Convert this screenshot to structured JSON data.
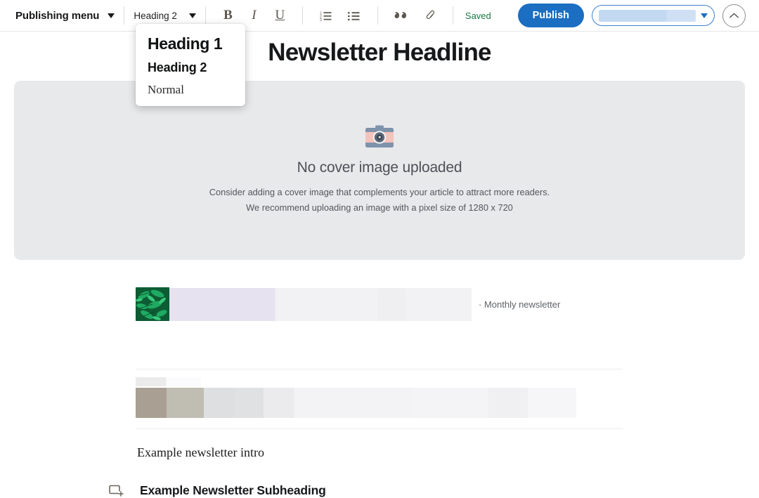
{
  "toolbar": {
    "publishing_menu_label": "Publishing menu",
    "style_selector_value": "Heading 2",
    "bold_label": "B",
    "italic_label": "I",
    "underline_label": "U",
    "numbered_list_icon": "numbered-list-icon",
    "bullet_list_icon": "bullet-list-icon",
    "quote_icon": "blockquote-icon",
    "link_icon": "link-icon",
    "save_status": "Saved",
    "save_status_color": "#1b7a45",
    "publish_label": "Publish",
    "publish_button_color": "#1b6ec2",
    "publish_select_value": "",
    "collapse_icon": "chevron-up-icon"
  },
  "style_dropdown": {
    "options": [
      {
        "label": "Heading 1",
        "style": "h1"
      },
      {
        "label": "Heading 2",
        "style": "h2"
      },
      {
        "label": "Normal",
        "style": "normal"
      }
    ]
  },
  "editor": {
    "headline": "Newsletter Headline",
    "cover": {
      "icon": "camera-icon",
      "title": "No cover image uploaded",
      "line1": "Consider adding a cover image that complements your article to attract more readers.",
      "line2": "We recommend uploading an image with a pixel size of 1280 x 720",
      "background_color": "#e8e9eb"
    },
    "embed": {
      "thumbnail_alt": "green-leaves-thumbnail",
      "meta_text": "· Monthly newsletter"
    },
    "intro_paragraph": "Example newsletter intro",
    "subheading": "Example Newsletter Subheading",
    "add_block_icon": "add-block-icon"
  }
}
